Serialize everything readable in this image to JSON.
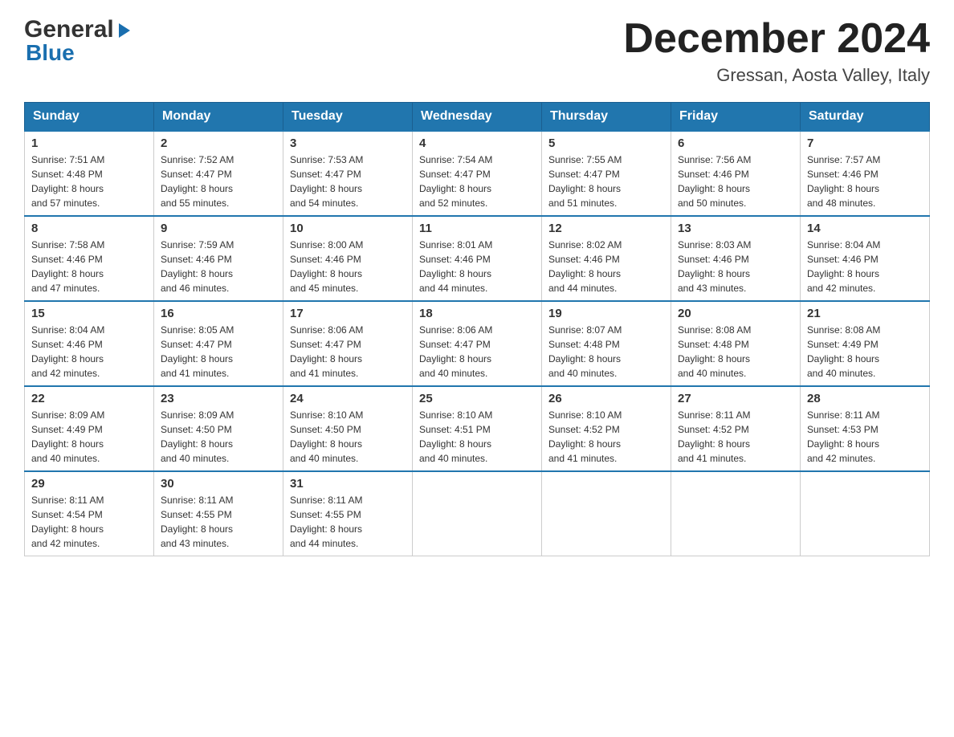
{
  "header": {
    "logo_line1": "General",
    "logo_arrow": "▶",
    "logo_line2": "Blue",
    "month_title": "December 2024",
    "location": "Gressan, Aosta Valley, Italy"
  },
  "days_of_week": [
    "Sunday",
    "Monday",
    "Tuesday",
    "Wednesday",
    "Thursday",
    "Friday",
    "Saturday"
  ],
  "weeks": [
    [
      {
        "day": "1",
        "sunrise": "7:51 AM",
        "sunset": "4:48 PM",
        "daylight": "8 hours and 57 minutes."
      },
      {
        "day": "2",
        "sunrise": "7:52 AM",
        "sunset": "4:47 PM",
        "daylight": "8 hours and 55 minutes."
      },
      {
        "day": "3",
        "sunrise": "7:53 AM",
        "sunset": "4:47 PM",
        "daylight": "8 hours and 54 minutes."
      },
      {
        "day": "4",
        "sunrise": "7:54 AM",
        "sunset": "4:47 PM",
        "daylight": "8 hours and 52 minutes."
      },
      {
        "day": "5",
        "sunrise": "7:55 AM",
        "sunset": "4:47 PM",
        "daylight": "8 hours and 51 minutes."
      },
      {
        "day": "6",
        "sunrise": "7:56 AM",
        "sunset": "4:46 PM",
        "daylight": "8 hours and 50 minutes."
      },
      {
        "day": "7",
        "sunrise": "7:57 AM",
        "sunset": "4:46 PM",
        "daylight": "8 hours and 48 minutes."
      }
    ],
    [
      {
        "day": "8",
        "sunrise": "7:58 AM",
        "sunset": "4:46 PM",
        "daylight": "8 hours and 47 minutes."
      },
      {
        "day": "9",
        "sunrise": "7:59 AM",
        "sunset": "4:46 PM",
        "daylight": "8 hours and 46 minutes."
      },
      {
        "day": "10",
        "sunrise": "8:00 AM",
        "sunset": "4:46 PM",
        "daylight": "8 hours and 45 minutes."
      },
      {
        "day": "11",
        "sunrise": "8:01 AM",
        "sunset": "4:46 PM",
        "daylight": "8 hours and 44 minutes."
      },
      {
        "day": "12",
        "sunrise": "8:02 AM",
        "sunset": "4:46 PM",
        "daylight": "8 hours and 44 minutes."
      },
      {
        "day": "13",
        "sunrise": "8:03 AM",
        "sunset": "4:46 PM",
        "daylight": "8 hours and 43 minutes."
      },
      {
        "day": "14",
        "sunrise": "8:04 AM",
        "sunset": "4:46 PM",
        "daylight": "8 hours and 42 minutes."
      }
    ],
    [
      {
        "day": "15",
        "sunrise": "8:04 AM",
        "sunset": "4:46 PM",
        "daylight": "8 hours and 42 minutes."
      },
      {
        "day": "16",
        "sunrise": "8:05 AM",
        "sunset": "4:47 PM",
        "daylight": "8 hours and 41 minutes."
      },
      {
        "day": "17",
        "sunrise": "8:06 AM",
        "sunset": "4:47 PM",
        "daylight": "8 hours and 41 minutes."
      },
      {
        "day": "18",
        "sunrise": "8:06 AM",
        "sunset": "4:47 PM",
        "daylight": "8 hours and 40 minutes."
      },
      {
        "day": "19",
        "sunrise": "8:07 AM",
        "sunset": "4:48 PM",
        "daylight": "8 hours and 40 minutes."
      },
      {
        "day": "20",
        "sunrise": "8:08 AM",
        "sunset": "4:48 PM",
        "daylight": "8 hours and 40 minutes."
      },
      {
        "day": "21",
        "sunrise": "8:08 AM",
        "sunset": "4:49 PM",
        "daylight": "8 hours and 40 minutes."
      }
    ],
    [
      {
        "day": "22",
        "sunrise": "8:09 AM",
        "sunset": "4:49 PM",
        "daylight": "8 hours and 40 minutes."
      },
      {
        "day": "23",
        "sunrise": "8:09 AM",
        "sunset": "4:50 PM",
        "daylight": "8 hours and 40 minutes."
      },
      {
        "day": "24",
        "sunrise": "8:10 AM",
        "sunset": "4:50 PM",
        "daylight": "8 hours and 40 minutes."
      },
      {
        "day": "25",
        "sunrise": "8:10 AM",
        "sunset": "4:51 PM",
        "daylight": "8 hours and 40 minutes."
      },
      {
        "day": "26",
        "sunrise": "8:10 AM",
        "sunset": "4:52 PM",
        "daylight": "8 hours and 41 minutes."
      },
      {
        "day": "27",
        "sunrise": "8:11 AM",
        "sunset": "4:52 PM",
        "daylight": "8 hours and 41 minutes."
      },
      {
        "day": "28",
        "sunrise": "8:11 AM",
        "sunset": "4:53 PM",
        "daylight": "8 hours and 42 minutes."
      }
    ],
    [
      {
        "day": "29",
        "sunrise": "8:11 AM",
        "sunset": "4:54 PM",
        "daylight": "8 hours and 42 minutes."
      },
      {
        "day": "30",
        "sunrise": "8:11 AM",
        "sunset": "4:55 PM",
        "daylight": "8 hours and 43 minutes."
      },
      {
        "day": "31",
        "sunrise": "8:11 AM",
        "sunset": "4:55 PM",
        "daylight": "8 hours and 44 minutes."
      },
      null,
      null,
      null,
      null
    ]
  ],
  "labels": {
    "sunrise_prefix": "Sunrise: ",
    "sunset_prefix": "Sunset: ",
    "daylight_prefix": "Daylight: "
  }
}
